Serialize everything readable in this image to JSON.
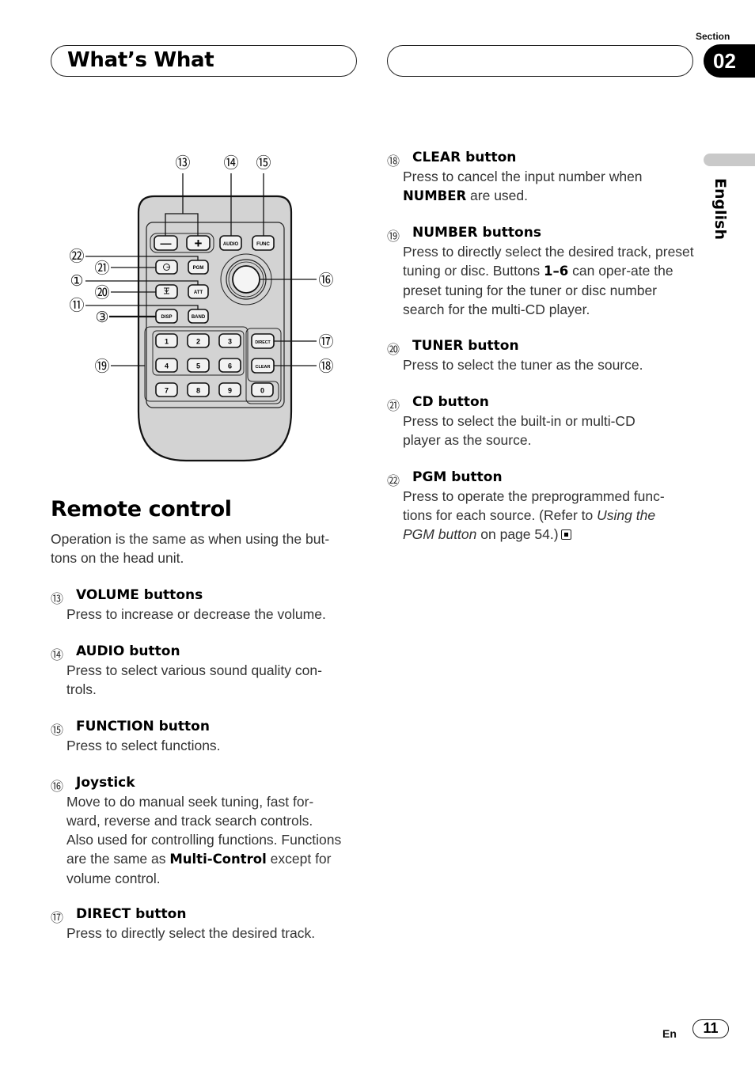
{
  "header": {
    "title": "What’s What",
    "section_label": "Section",
    "section_number": "02",
    "language_tab": "English"
  },
  "figure": {
    "remote_buttons": {
      "volume_minus": "—",
      "volume_plus": "+",
      "audio": "AUDIO",
      "func": "FUNC",
      "pgm": "PGM",
      "att": "ATT",
      "disp": "DISP",
      "band": "BAND",
      "direct": "DIRECT",
      "clear": "CLEAR",
      "number_keys": [
        "1",
        "2",
        "3",
        "4",
        "5",
        "6",
        "7",
        "8",
        "9",
        "0"
      ]
    },
    "callouts": {
      "c13": "⑬",
      "c14": "⑭",
      "c15": "⑮",
      "c22": "㉒",
      "c21": "㉑",
      "c1": "①",
      "c20": "⑳",
      "c11": "⑪",
      "c3": "③",
      "c19": "⑲",
      "c16": "⑯",
      "c17": "⑰",
      "c18": "⑱"
    }
  },
  "section": {
    "title": "Remote control",
    "intro": "Operation is the same as when using the but-tons on the head unit."
  },
  "items": [
    {
      "num": "⑬",
      "head": "VOLUME buttons",
      "desc": "Press to increase or decrease the volume."
    },
    {
      "num": "⑭",
      "head": "AUDIO button",
      "desc": "Press to select various sound quality con-trols."
    },
    {
      "num": "⑮",
      "head": "FUNCTION button",
      "desc": "Press to select functions."
    },
    {
      "num": "⑯",
      "head": "Joystick",
      "desc_a": "Move to do manual seek tuning, fast for-ward, reverse and track search controls. Also used for controlling functions. Functions are the same as ",
      "desc_b": "Multi-Control",
      "desc_c": " except for volume control."
    },
    {
      "num": "⑰",
      "head": "DIRECT button",
      "desc": "Press to directly select the desired track."
    },
    {
      "num": "⑱",
      "head": "CLEAR button",
      "desc_a": "Press to cancel the input number when ",
      "desc_b": "NUMBER",
      "desc_c": " are used."
    },
    {
      "num": "⑲",
      "head": "NUMBER buttons",
      "desc_a": "Press to directly select the desired track, preset tuning or disc. Buttons ",
      "desc_b": "1–6",
      "desc_c": " can oper-ate the preset tuning for the tuner or disc number search for the multi-CD player."
    },
    {
      "num": "⑳",
      "head": "TUNER button",
      "desc": "Press to select the tuner as the source."
    },
    {
      "num": "㉑",
      "head": "CD button",
      "desc": "Press to select the built-in or multi-CD player as the source."
    },
    {
      "num": "㉒",
      "head": "PGM button",
      "desc_a": "Press to operate the preprogrammed func-tions for each source. (Refer to ",
      "desc_b": "Using the PGM button",
      "desc_c": " on page 54.)"
    }
  ],
  "footer": {
    "lang_code": "En",
    "page_number": "11"
  }
}
